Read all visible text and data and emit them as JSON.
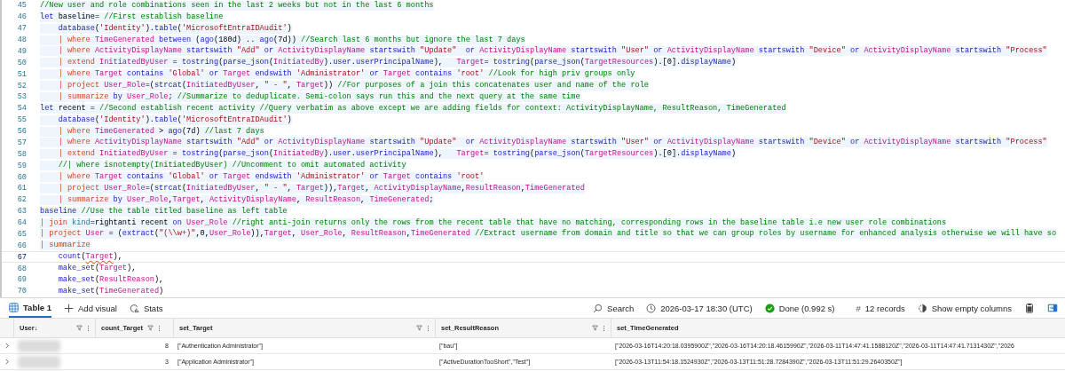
{
  "editor": {
    "lines": [
      {
        "number": "45",
        "highlighted": true,
        "current": false,
        "tokens": [
          {
            "t": "//New user and role combinations seen in the last 2 weeks but not in the last 6 months",
            "kind": "comment"
          }
        ]
      },
      {
        "number": "46",
        "highlighted": true,
        "current": false,
        "tokens": [
          {
            "t": "let",
            "kind": "keyword"
          },
          {
            "t": " baseline= ",
            "kind": "plain"
          },
          {
            "t": "//First establish baseline",
            "kind": "comment"
          }
        ]
      },
      {
        "number": "47",
        "highlighted": true,
        "current": false,
        "tokens": [
          {
            "t": "    database",
            "kind": "keyword"
          },
          {
            "t": "(",
            "kind": "plain"
          },
          {
            "t": "'Identity'",
            "kind": "string"
          },
          {
            "t": ").",
            "kind": "plain"
          },
          {
            "t": "table",
            "kind": "keyword"
          },
          {
            "t": "(",
            "kind": "plain"
          },
          {
            "t": "'MicrosoftEntraIDAudit'",
            "kind": "string"
          },
          {
            "t": ")",
            "kind": "plain"
          }
        ]
      },
      {
        "number": "48",
        "highlighted": true,
        "current": false,
        "tokens": [
          {
            "t": "    | where ",
            "kind": "operator"
          },
          {
            "t": "TimeGenerated",
            "kind": "column"
          },
          {
            "t": " between ",
            "kind": "keyword"
          },
          {
            "t": "(",
            "kind": "plain"
          },
          {
            "t": "ago",
            "kind": "keyword"
          },
          {
            "t": "(180d) .. ",
            "kind": "plain"
          },
          {
            "t": "ago",
            "kind": "keyword"
          },
          {
            "t": "(7d)) ",
            "kind": "plain"
          },
          {
            "t": "//Search last 6 months but ignore the last 7 days",
            "kind": "comment"
          }
        ]
      },
      {
        "number": "49",
        "highlighted": true,
        "current": false,
        "tokens": [
          {
            "t": "    | where ",
            "kind": "operator"
          },
          {
            "t": "ActivityDisplayName",
            "kind": "column"
          },
          {
            "t": " startswith ",
            "kind": "keyword"
          },
          {
            "t": "\"Add\"",
            "kind": "string"
          },
          {
            "t": " or ",
            "kind": "keyword"
          },
          {
            "t": "ActivityDisplayName",
            "kind": "column"
          },
          {
            "t": " startswith ",
            "kind": "keyword"
          },
          {
            "t": "\"Update\"",
            "kind": "string"
          },
          {
            "t": "  or ",
            "kind": "keyword"
          },
          {
            "t": "ActivityDisplayName",
            "kind": "column"
          },
          {
            "t": " startswith ",
            "kind": "keyword"
          },
          {
            "t": "\"User\"",
            "kind": "string"
          },
          {
            "t": " or ",
            "kind": "keyword"
          },
          {
            "t": "ActivityDisplayName",
            "kind": "column"
          },
          {
            "t": " startswith ",
            "kind": "keyword"
          },
          {
            "t": "\"Device\"",
            "kind": "string"
          },
          {
            "t": " or ",
            "kind": "keyword"
          },
          {
            "t": "ActivityDisplayName",
            "kind": "column"
          },
          {
            "t": " startswith ",
            "kind": "keyword"
          },
          {
            "t": "\"Process\"",
            "kind": "string"
          }
        ]
      },
      {
        "number": "50",
        "highlighted": true,
        "current": false,
        "tokens": [
          {
            "t": "    | extend ",
            "kind": "operator"
          },
          {
            "t": "InitiatedByUser",
            "kind": "column"
          },
          {
            "t": " = ",
            "kind": "plain"
          },
          {
            "t": "tostring",
            "kind": "keyword"
          },
          {
            "t": "(",
            "kind": "plain"
          },
          {
            "t": "parse_json",
            "kind": "keyword"
          },
          {
            "t": "(",
            "kind": "plain"
          },
          {
            "t": "InitiatedBy",
            "kind": "column"
          },
          {
            "t": ").",
            "kind": "plain"
          },
          {
            "t": "user",
            "kind": "keyword"
          },
          {
            "t": ".",
            "kind": "plain"
          },
          {
            "t": "userPrincipalName",
            "kind": "keyword"
          },
          {
            "t": "),   ",
            "kind": "plain"
          },
          {
            "t": "Target",
            "kind": "column"
          },
          {
            "t": "= ",
            "kind": "plain"
          },
          {
            "t": "tostring",
            "kind": "keyword"
          },
          {
            "t": "(",
            "kind": "plain"
          },
          {
            "t": "parse_json",
            "kind": "keyword"
          },
          {
            "t": "(",
            "kind": "plain"
          },
          {
            "t": "TargetResources",
            "kind": "column"
          },
          {
            "t": ").[0].",
            "kind": "plain"
          },
          {
            "t": "displayName",
            "kind": "keyword"
          },
          {
            "t": ")",
            "kind": "plain"
          }
        ]
      },
      {
        "number": "51",
        "highlighted": true,
        "current": false,
        "tokens": [
          {
            "t": "    | where ",
            "kind": "operator"
          },
          {
            "t": "Target",
            "kind": "column"
          },
          {
            "t": " contains ",
            "kind": "keyword"
          },
          {
            "t": "'Global'",
            "kind": "string"
          },
          {
            "t": " or ",
            "kind": "keyword"
          },
          {
            "t": "Target",
            "kind": "column"
          },
          {
            "t": " endswith ",
            "kind": "keyword"
          },
          {
            "t": "'Administrator'",
            "kind": "string"
          },
          {
            "t": " or ",
            "kind": "keyword"
          },
          {
            "t": "Target",
            "kind": "column"
          },
          {
            "t": " contains ",
            "kind": "keyword"
          },
          {
            "t": "'root' ",
            "kind": "string"
          },
          {
            "t": "//Look for high priv groups only",
            "kind": "comment"
          }
        ]
      },
      {
        "number": "52",
        "highlighted": true,
        "current": false,
        "tokens": [
          {
            "t": "    | project ",
            "kind": "operator"
          },
          {
            "t": "User_Role",
            "kind": "column"
          },
          {
            "t": "=(",
            "kind": "plain"
          },
          {
            "t": "strcat",
            "kind": "keyword"
          },
          {
            "t": "(",
            "kind": "plain"
          },
          {
            "t": "InitiatedByUser",
            "kind": "column"
          },
          {
            "t": ", ",
            "kind": "plain"
          },
          {
            "t": "\" - \"",
            "kind": "string"
          },
          {
            "t": ", ",
            "kind": "plain"
          },
          {
            "t": "Target",
            "kind": "column"
          },
          {
            "t": ")) ",
            "kind": "plain"
          },
          {
            "t": "//For purposes of a join this concatenates user and name of the role",
            "kind": "comment"
          }
        ]
      },
      {
        "number": "53",
        "highlighted": true,
        "current": false,
        "tokens": [
          {
            "t": "    | summarize ",
            "kind": "operator"
          },
          {
            "t": "by ",
            "kind": "keyword"
          },
          {
            "t": "User_Role",
            "kind": "column"
          },
          {
            "t": "; ",
            "kind": "plain"
          },
          {
            "t": "//Summarize to deduplicate. Semi-colon says run this and the next query at the same time",
            "kind": "comment"
          }
        ]
      },
      {
        "number": "54",
        "highlighted": true,
        "current": false,
        "tokens": [
          {
            "t": "let",
            "kind": "keyword"
          },
          {
            "t": " recent = ",
            "kind": "plain"
          },
          {
            "t": "//Second establish recent activity //Query verbatim as above except we are adding fields for context: ActivityDisplayName, ResultReason, TimeGenerated",
            "kind": "comment"
          }
        ]
      },
      {
        "number": "55",
        "highlighted": true,
        "current": false,
        "tokens": [
          {
            "t": "    database",
            "kind": "keyword"
          },
          {
            "t": "(",
            "kind": "plain"
          },
          {
            "t": "'Identity'",
            "kind": "string"
          },
          {
            "t": ").",
            "kind": "plain"
          },
          {
            "t": "table",
            "kind": "keyword"
          },
          {
            "t": "(",
            "kind": "plain"
          },
          {
            "t": "'MicrosoftEntraIDAudit'",
            "kind": "string"
          },
          {
            "t": ")",
            "kind": "plain"
          }
        ]
      },
      {
        "number": "56",
        "highlighted": true,
        "current": false,
        "tokens": [
          {
            "t": "    | where ",
            "kind": "operator"
          },
          {
            "t": "TimeGenerated",
            "kind": "column"
          },
          {
            "t": " > ",
            "kind": "plain"
          },
          {
            "t": "ago",
            "kind": "keyword"
          },
          {
            "t": "(7d) ",
            "kind": "plain"
          },
          {
            "t": "//last 7 days",
            "kind": "comment"
          }
        ]
      },
      {
        "number": "57",
        "highlighted": true,
        "current": false,
        "tokens": [
          {
            "t": "    | where ",
            "kind": "operator"
          },
          {
            "t": "ActivityDisplayName",
            "kind": "column"
          },
          {
            "t": " startswith ",
            "kind": "keyword"
          },
          {
            "t": "\"Add\"",
            "kind": "string"
          },
          {
            "t": " or ",
            "kind": "keyword"
          },
          {
            "t": "ActivityDisplayName",
            "kind": "column"
          },
          {
            "t": " startswith ",
            "kind": "keyword"
          },
          {
            "t": "\"Update\"",
            "kind": "string"
          },
          {
            "t": "  or ",
            "kind": "keyword"
          },
          {
            "t": "ActivityDisplayName",
            "kind": "column"
          },
          {
            "t": " startswith ",
            "kind": "keyword"
          },
          {
            "t": "\"User\"",
            "kind": "string"
          },
          {
            "t": " or ",
            "kind": "keyword"
          },
          {
            "t": "ActivityDisplayName",
            "kind": "column"
          },
          {
            "t": " startswith ",
            "kind": "keyword"
          },
          {
            "t": "\"Device\"",
            "kind": "string"
          },
          {
            "t": " or ",
            "kind": "keyword"
          },
          {
            "t": "ActivityDisplayName",
            "kind": "column"
          },
          {
            "t": " startswith ",
            "kind": "keyword"
          },
          {
            "t": "\"Process\"",
            "kind": "string"
          }
        ]
      },
      {
        "number": "58",
        "highlighted": true,
        "current": false,
        "tokens": [
          {
            "t": "    | extend ",
            "kind": "operator"
          },
          {
            "t": "InitiatedByUser",
            "kind": "column"
          },
          {
            "t": " = ",
            "kind": "plain"
          },
          {
            "t": "tostring",
            "kind": "keyword"
          },
          {
            "t": "(",
            "kind": "plain"
          },
          {
            "t": "parse_json",
            "kind": "keyword"
          },
          {
            "t": "(",
            "kind": "plain"
          },
          {
            "t": "InitiatedBy",
            "kind": "column"
          },
          {
            "t": ").",
            "kind": "plain"
          },
          {
            "t": "user",
            "kind": "keyword"
          },
          {
            "t": ".",
            "kind": "plain"
          },
          {
            "t": "userPrincipalName",
            "kind": "keyword"
          },
          {
            "t": "),   ",
            "kind": "plain"
          },
          {
            "t": "Target",
            "kind": "column"
          },
          {
            "t": "= ",
            "kind": "plain"
          },
          {
            "t": "tostring",
            "kind": "keyword"
          },
          {
            "t": "(",
            "kind": "plain"
          },
          {
            "t": "parse_json",
            "kind": "keyword"
          },
          {
            "t": "(",
            "kind": "plain"
          },
          {
            "t": "TargetResources",
            "kind": "column"
          },
          {
            "t": ").[0].",
            "kind": "plain"
          },
          {
            "t": "displayName",
            "kind": "keyword"
          },
          {
            "t": ")",
            "kind": "plain"
          }
        ]
      },
      {
        "number": "59",
        "highlighted": true,
        "current": false,
        "tokens": [
          {
            "t": "    //| where isnotempty(InitiatedByUser) //Uncomment to omit automated activity",
            "kind": "comment"
          }
        ]
      },
      {
        "number": "60",
        "highlighted": true,
        "current": false,
        "tokens": [
          {
            "t": "    | where ",
            "kind": "operator"
          },
          {
            "t": "Target",
            "kind": "column"
          },
          {
            "t": " contains ",
            "kind": "keyword"
          },
          {
            "t": "'Global'",
            "kind": "string"
          },
          {
            "t": " or ",
            "kind": "keyword"
          },
          {
            "t": "Target",
            "kind": "column"
          },
          {
            "t": " endswith ",
            "kind": "keyword"
          },
          {
            "t": "'Administrator'",
            "kind": "string"
          },
          {
            "t": " or ",
            "kind": "keyword"
          },
          {
            "t": "Target",
            "kind": "column"
          },
          {
            "t": " contains ",
            "kind": "keyword"
          },
          {
            "t": "'root'",
            "kind": "string"
          }
        ]
      },
      {
        "number": "61",
        "highlighted": true,
        "current": false,
        "tokens": [
          {
            "t": "    | project ",
            "kind": "operator"
          },
          {
            "t": "User_Role",
            "kind": "column"
          },
          {
            "t": "=(",
            "kind": "plain"
          },
          {
            "t": "strcat",
            "kind": "keyword"
          },
          {
            "t": "(",
            "kind": "plain"
          },
          {
            "t": "InitiatedByUser",
            "kind": "column"
          },
          {
            "t": ", ",
            "kind": "plain"
          },
          {
            "t": "\" - \"",
            "kind": "string"
          },
          {
            "t": ", ",
            "kind": "plain"
          },
          {
            "t": "Target",
            "kind": "column"
          },
          {
            "t": ")),",
            "kind": "plain"
          },
          {
            "t": "Target",
            "kind": "column"
          },
          {
            "t": ", ",
            "kind": "plain"
          },
          {
            "t": "ActivityDisplayName",
            "kind": "column"
          },
          {
            "t": ",",
            "kind": "plain"
          },
          {
            "t": "ResultReason",
            "kind": "column"
          },
          {
            "t": ",",
            "kind": "plain"
          },
          {
            "t": "TimeGenerated",
            "kind": "column"
          }
        ]
      },
      {
        "number": "62",
        "highlighted": true,
        "current": false,
        "tokens": [
          {
            "t": "    | summarize ",
            "kind": "operator"
          },
          {
            "t": "by ",
            "kind": "keyword"
          },
          {
            "t": "User_Role",
            "kind": "column"
          },
          {
            "t": ",",
            "kind": "plain"
          },
          {
            "t": "Target",
            "kind": "column"
          },
          {
            "t": ", ",
            "kind": "plain"
          },
          {
            "t": "ActivityDisplayName",
            "kind": "column"
          },
          {
            "t": ", ",
            "kind": "plain"
          },
          {
            "t": "ResultReason",
            "kind": "column"
          },
          {
            "t": ", ",
            "kind": "plain"
          },
          {
            "t": "TimeGenerated",
            "kind": "column"
          },
          {
            "t": ";",
            "kind": "plain"
          }
        ]
      },
      {
        "number": "63",
        "highlighted": true,
        "current": false,
        "tokens": [
          {
            "t": "baseline ",
            "kind": "keyword"
          },
          {
            "t": "//Use the table titled baseline as left table",
            "kind": "comment"
          }
        ]
      },
      {
        "number": "64",
        "highlighted": true,
        "current": false,
        "tokens": [
          {
            "t": "| join ",
            "kind": "operator"
          },
          {
            "t": "kind",
            "kind": "parameter"
          },
          {
            "t": "=rightanti recent ",
            "kind": "plain"
          },
          {
            "t": "on ",
            "kind": "keyword"
          },
          {
            "t": "User_Role",
            "kind": "column"
          },
          {
            "t": " //right anti-join returns only the rows from the recent table that have no matching, corresponding rows in the baseline table i.e new user role combinations",
            "kind": "comment"
          }
        ]
      },
      {
        "number": "65",
        "highlighted": true,
        "current": false,
        "tokens": [
          {
            "t": "| project ",
            "kind": "operator"
          },
          {
            "t": "User",
            "kind": "column"
          },
          {
            "t": " = (",
            "kind": "plain"
          },
          {
            "t": "extract",
            "kind": "keyword"
          },
          {
            "t": "(",
            "kind": "plain"
          },
          {
            "t": "\"(\\\\w+)\"",
            "kind": "string"
          },
          {
            "t": ",0,",
            "kind": "plain"
          },
          {
            "t": "User_Role",
            "kind": "column"
          },
          {
            "t": ")),",
            "kind": "plain"
          },
          {
            "t": "Target",
            "kind": "column"
          },
          {
            "t": ", ",
            "kind": "plain"
          },
          {
            "t": "User_Role",
            "kind": "column"
          },
          {
            "t": ", ",
            "kind": "plain"
          },
          {
            "t": "ResultReason",
            "kind": "column"
          },
          {
            "t": ",",
            "kind": "plain"
          },
          {
            "t": "TimeGenerated",
            "kind": "column"
          },
          {
            "t": " //Extract username from domain and title so that we can group roles by username for enhanced analysis otherwise we will have so",
            "kind": "comment"
          }
        ]
      },
      {
        "number": "66",
        "highlighted": true,
        "current": false,
        "tokens": [
          {
            "t": "| summarize",
            "kind": "operator"
          }
        ]
      },
      {
        "number": "67",
        "highlighted": false,
        "current": true,
        "tokens": [
          {
            "t": "    count",
            "kind": "keyword"
          },
          {
            "t": "(",
            "kind": "plain"
          },
          {
            "t": "Target",
            "kind": "error"
          },
          {
            "t": "),",
            "kind": "plain"
          }
        ]
      },
      {
        "number": "68",
        "highlighted": false,
        "current": false,
        "tokens": [
          {
            "t": "    make_set",
            "kind": "keyword"
          },
          {
            "t": "(",
            "kind": "plain"
          },
          {
            "t": "Target",
            "kind": "column"
          },
          {
            "t": "),",
            "kind": "plain"
          }
        ]
      },
      {
        "number": "69",
        "highlighted": false,
        "current": false,
        "tokens": [
          {
            "t": "    make_set",
            "kind": "keyword"
          },
          {
            "t": "(",
            "kind": "plain"
          },
          {
            "t": "ResultReason",
            "kind": "column"
          },
          {
            "t": "),",
            "kind": "plain"
          }
        ]
      },
      {
        "number": "70",
        "highlighted": false,
        "current": false,
        "tokens": [
          {
            "t": "    make_set",
            "kind": "keyword"
          },
          {
            "t": "(",
            "kind": "plain"
          },
          {
            "t": "TimeGenerated",
            "kind": "column"
          },
          {
            "t": ")",
            "kind": "plain"
          }
        ]
      }
    ]
  },
  "results": {
    "tabs": [
      {
        "label": "Table 1",
        "selected": true
      }
    ],
    "add_visual": "Add visual",
    "stats": "Stats",
    "search": "Search",
    "query_time": "2026-03-17 18:30 (UTC)",
    "status": "Done (0.992 s)",
    "records_mark": "#",
    "records": "12 records",
    "show_empty_columns": "Show empty columns",
    "columns": [
      {
        "name": "User",
        "sort": "↓",
        "filter": true,
        "menu": true,
        "kind": "text"
      },
      {
        "name": "count_Target",
        "filter": true,
        "menu": true,
        "kind": "number"
      },
      {
        "name": "set_Target",
        "filter": true,
        "menu": true,
        "kind": "text"
      },
      {
        "name": "set_ResultReason",
        "filter": true,
        "menu": true,
        "kind": "text"
      },
      {
        "name": "set_TimeGenerated",
        "filter": false,
        "menu": false,
        "kind": "text"
      }
    ],
    "rows": [
      {
        "cells": [
          null,
          "8",
          "[\"Authentication Administrator\"]",
          "[\"bau\"]",
          "[\"2026-03-16T14:20:18.0395900Z\",\"2026-03-16T14:20:18.4615990Z\",\"2026-03-11T14:47:41.1588120Z\",\"2026-03-11T14:47:41.7131430Z\",\"2026"
        ]
      },
      {
        "cells": [
          null,
          "3",
          "[\"Application Administrator\"]",
          "[\"ActiveDurationTooShort\",\"Test\"]",
          "[\"2026-03-13T11:54:18.1524930Z\",\"2026-03-13T11:51:28.7284390Z\",\"2026-03-13T11:51:29.2640350Z\"]"
        ]
      }
    ]
  }
}
